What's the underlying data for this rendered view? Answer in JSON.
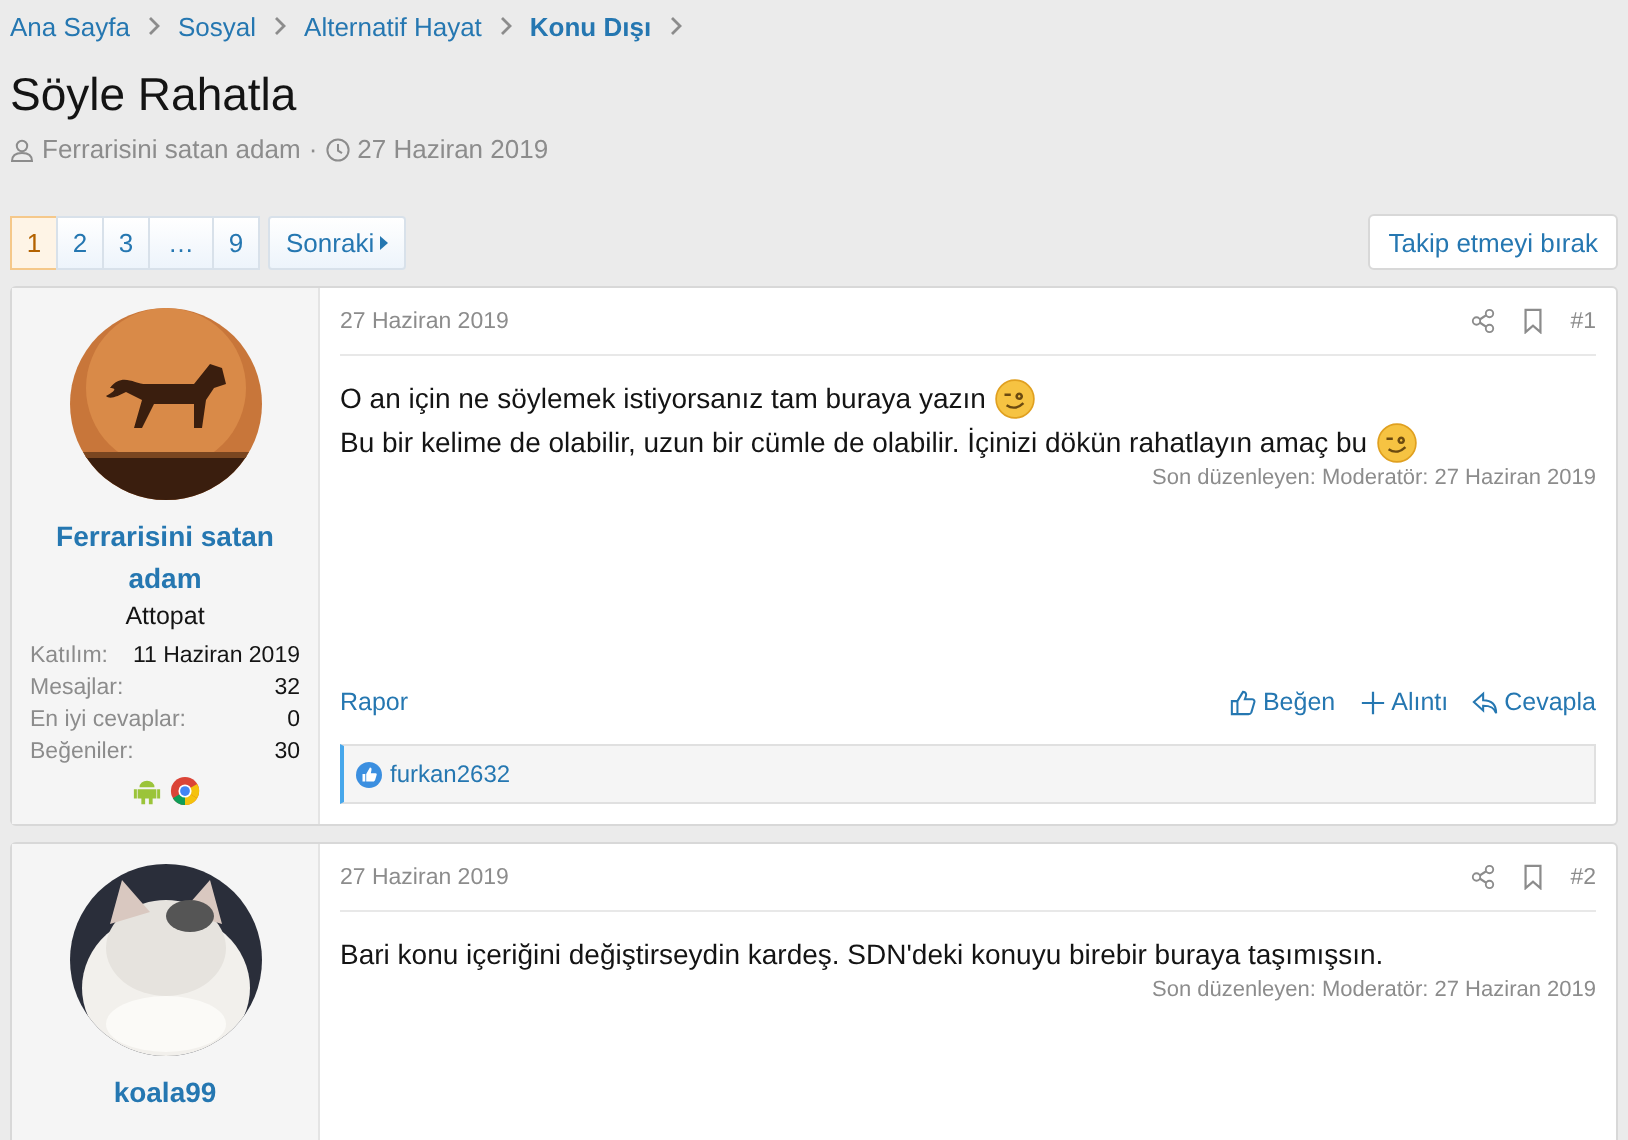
{
  "breadcrumbs": [
    {
      "label": "Ana Sayfa",
      "current": false
    },
    {
      "label": "Sosyal",
      "current": false
    },
    {
      "label": "Alternatif Hayat",
      "current": false
    },
    {
      "label": "Konu Dışı",
      "current": true
    }
  ],
  "title": "Söyle Rahatla",
  "meta": {
    "author": "Ferrarisini satan adam",
    "separator": "·",
    "date": "27 Haziran 2019"
  },
  "pagination": {
    "pages": [
      {
        "label": "1",
        "selected": true
      },
      {
        "label": "2",
        "selected": false
      },
      {
        "label": "3",
        "selected": false
      },
      {
        "label": "…",
        "selected": false
      },
      {
        "label": "9",
        "selected": false
      }
    ],
    "next": "Sonraki"
  },
  "watch_button": "Takip etmeyi bırak",
  "posts": [
    {
      "user": {
        "name": "Ferrarisini satan adam",
        "title": "Attopat",
        "stats": [
          {
            "label": "Katılım:",
            "value": "11 Haziran 2019"
          },
          {
            "label": "Mesajlar:",
            "value": "32"
          },
          {
            "label": "En iyi cevaplar:",
            "value": "0"
          },
          {
            "label": "Beğeniler:",
            "value": "30"
          }
        ],
        "devices": true
      },
      "date": "27 Haziran 2019",
      "number": "#1",
      "lines": [
        {
          "text": "O an için ne söylemek istiyorsanız tam buraya yazın",
          "emoji": true
        },
        {
          "text": "Bu bir kelime de olabilir, uzun bir cümle de olabilir. İçinizi dökün rahatlayın amaç bu",
          "emoji": true
        }
      ],
      "edited": "Son düzenleyen: Moderatör: 27 Haziran 2019",
      "report": "Rapor",
      "actions": [
        {
          "kind": "like",
          "label": "Beğen"
        },
        {
          "kind": "quote",
          "label": "Alıntı"
        },
        {
          "kind": "reply",
          "label": "Cevapla"
        }
      ],
      "likes": "furkan2632"
    },
    {
      "user": {
        "name": "koala99",
        "devices": false
      },
      "date": "27 Haziran 2019",
      "number": "#2",
      "lines": [
        {
          "text": "Bari konu içeriğini değiştirseydin kardeş. SDN'deki konuyu birebir buraya taşımışsın."
        }
      ],
      "edited": "Son düzenleyen: Moderatör: 27 Haziran 2019"
    }
  ]
}
